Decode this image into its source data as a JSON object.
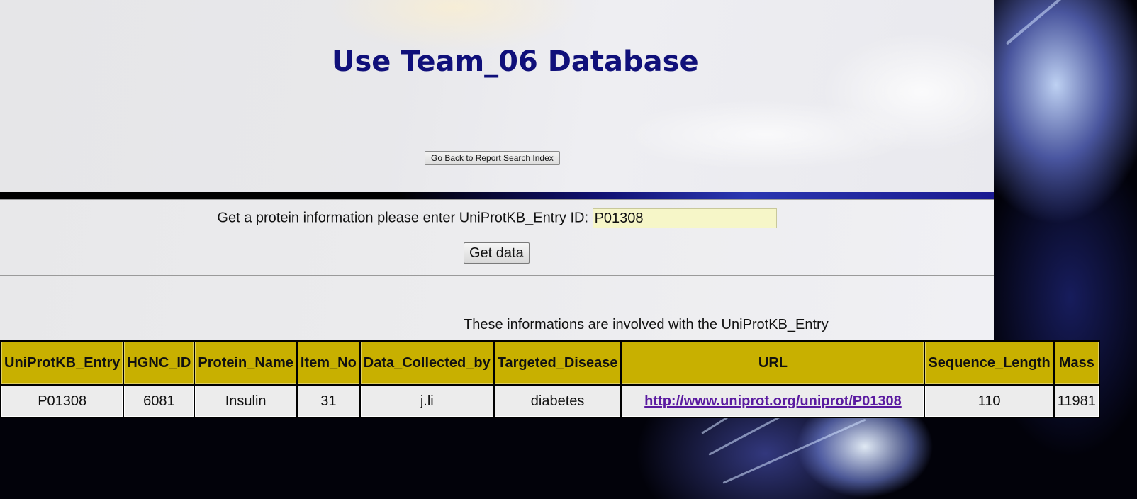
{
  "page": {
    "title": "Use Team_06 Database",
    "back_button_label": "Go Back to Report Search Index"
  },
  "search": {
    "prompt": "Get a protein information please enter UniProtKB_Entry ID:",
    "entry_value": "P01308",
    "submit_label": "Get data"
  },
  "results": {
    "caption": "These informations are involved with the UniProtKB_Entry",
    "columns": [
      "UniProtKB_Entry",
      "HGNC_ID",
      "Protein_Name",
      "Item_No",
      "Data_Collected_by",
      "Targeted_Disease",
      "URL",
      "Sequence_Length",
      "Mass"
    ],
    "rows": [
      [
        "P01308",
        "6081",
        "Insulin",
        "31",
        "j.li",
        "diabetes",
        "http://www.uniprot.org/uniprot/P01308",
        "110",
        "11981"
      ]
    ]
  },
  "colors": {
    "title": "#10107a",
    "table_header_bg": "#c8b000",
    "input_bg": "#f6f6c8",
    "link": "#5a1aa0"
  }
}
